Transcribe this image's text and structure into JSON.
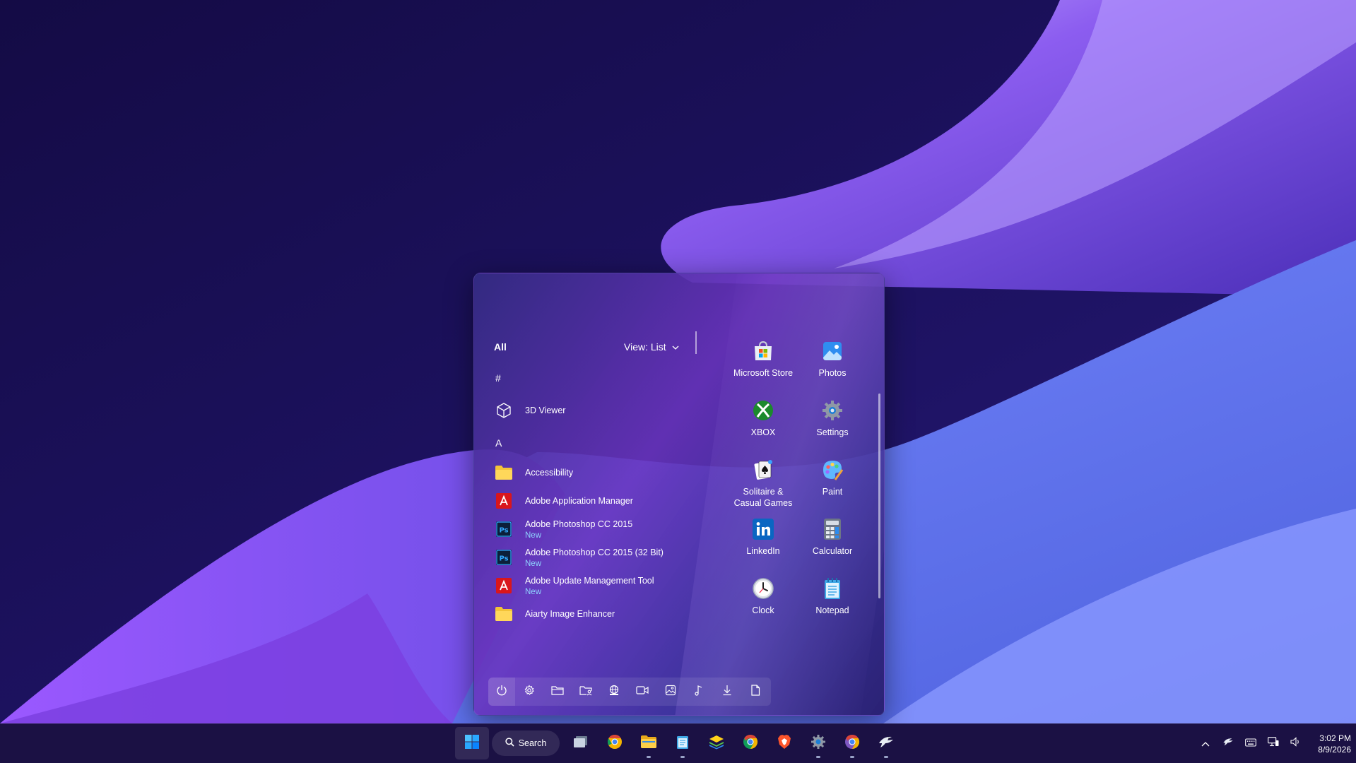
{
  "start_menu": {
    "all_label": "All",
    "view_label": "View: List",
    "app_list": [
      {
        "type": "letter",
        "label": "#"
      },
      {
        "type": "app",
        "name": "3D Viewer",
        "icon": "cube-icon"
      },
      {
        "type": "letter",
        "label": "A"
      },
      {
        "type": "app",
        "name": "Accessibility",
        "icon": "folder-icon"
      },
      {
        "type": "app",
        "name": "Adobe Application Manager",
        "icon": "adobe-icon"
      },
      {
        "type": "app",
        "name": "Adobe Photoshop CC 2015",
        "badge": "New",
        "icon": "photoshop-icon"
      },
      {
        "type": "app",
        "name": "Adobe Photoshop CC 2015 (32 Bit)",
        "badge": "New",
        "icon": "photoshop-icon"
      },
      {
        "type": "app",
        "name": "Adobe Update Management Tool",
        "badge": "New",
        "icon": "adobe-icon"
      },
      {
        "type": "app",
        "name": "Aiarty Image Enhancer",
        "icon": "folder-icon"
      }
    ],
    "pinned": [
      {
        "label": "Microsoft Store",
        "icon": "store-icon"
      },
      {
        "label": "Photos",
        "icon": "photos-icon"
      },
      {
        "label": "XBOX",
        "icon": "xbox-icon"
      },
      {
        "label": "Settings",
        "icon": "settings-gear-icon"
      },
      {
        "label": "Solitaire & Casual Games",
        "icon": "solitaire-icon"
      },
      {
        "label": "Paint",
        "icon": "paint-palette-icon"
      },
      {
        "label": "LinkedIn",
        "icon": "linkedin-icon"
      },
      {
        "label": "Calculator",
        "icon": "calculator-icon"
      },
      {
        "label": "Clock",
        "icon": "clock-icon"
      },
      {
        "label": "Notepad",
        "icon": "notepad-icon"
      }
    ],
    "bottom_buttons": [
      "power-icon",
      "gear-icon",
      "file-explorer-icon",
      "personal-folder-icon",
      "network-globe-icon",
      "videos-icon",
      "pictures-icon",
      "music-icon",
      "downloads-icon",
      "documents-icon"
    ]
  },
  "taskbar": {
    "search_label": "Search",
    "apps": [
      {
        "name": "task-view",
        "icon": "task-view-icon",
        "running": false
      },
      {
        "name": "chrome-canary",
        "icon": "chrome-icon",
        "running": false
      },
      {
        "name": "file-explorer",
        "icon": "folder-icon",
        "running": true
      },
      {
        "name": "notepad",
        "icon": "notepad-icon",
        "running": true
      },
      {
        "name": "bluestacks",
        "icon": "bluestacks-icon",
        "running": false
      },
      {
        "name": "chrome",
        "icon": "chrome-icon",
        "running": false
      },
      {
        "name": "brave",
        "icon": "brave-icon",
        "running": false
      },
      {
        "name": "settings",
        "icon": "gear-icon",
        "running": true
      },
      {
        "name": "chrome-beta",
        "icon": "chrome-icon",
        "running": true
      },
      {
        "name": "app-bird",
        "icon": "bird-icon",
        "running": true
      }
    ],
    "tray_icons": [
      "chevron-up-icon",
      "bird-tray-icon",
      "keyboard-icon",
      "network-icon",
      "volume-icon"
    ],
    "time": "3:02 PM",
    "date": "8/9/2026"
  },
  "colors": {
    "accent": "#0a84ff",
    "new_badge": "#8fd3ff",
    "wallpaper_dark": "#1a0f4f",
    "wallpaper_light": "#a987f5"
  }
}
